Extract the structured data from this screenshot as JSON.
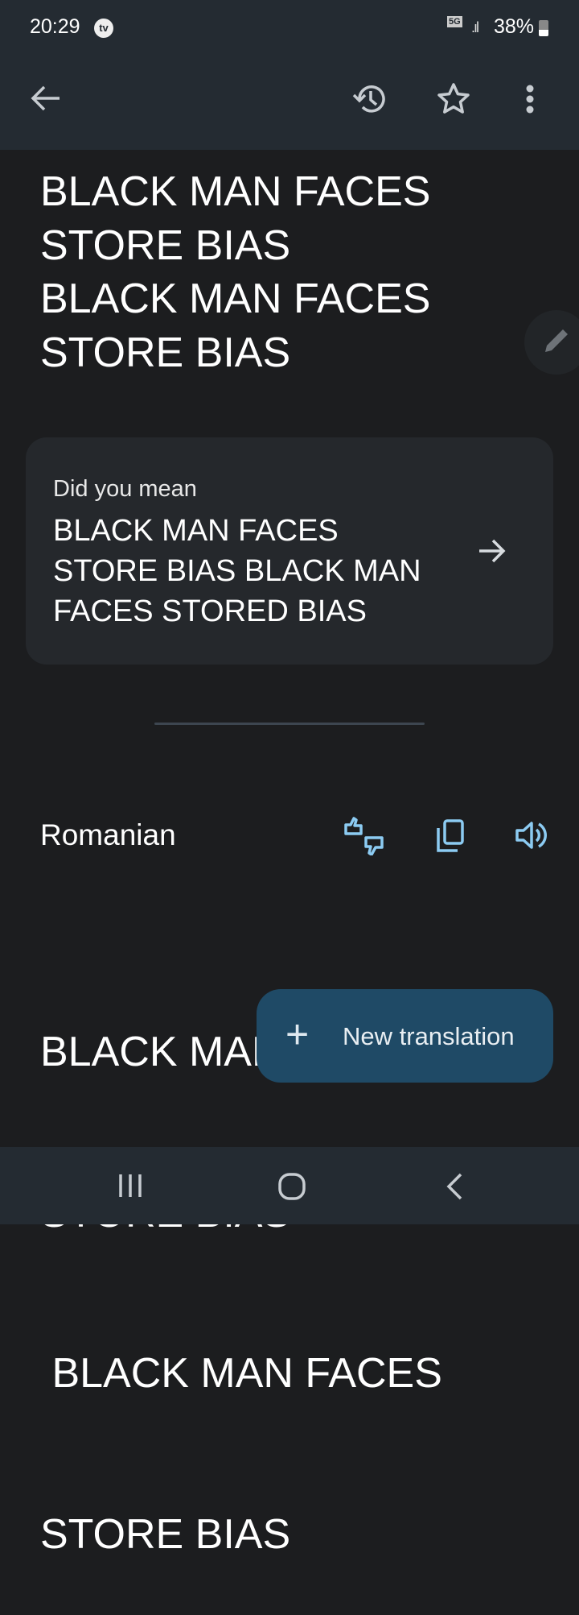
{
  "status_bar": {
    "time": "20:29",
    "tv_badge": "tv",
    "network": "5G",
    "battery": "38%",
    "battery_level": 0.38
  },
  "app_bar": {
    "icons": [
      "arrow-back-icon",
      "history-icon",
      "star-icon",
      "more-vert-icon"
    ]
  },
  "source": {
    "lines": [
      "BLACK MAN FACES",
      "STORE BIAS",
      "BLACK MAN FACES",
      "STORE BIAS"
    ]
  },
  "suggestion": {
    "label": "Did you mean",
    "lines": [
      "BLACK MAN FACES",
      "STORE BIAS BLACK MAN",
      "FACES STORED BIAS"
    ]
  },
  "target": {
    "language": "Romanian",
    "lines": [
      "BLACK MAN FACES",
      "STORE BIAS",
      " BLACK MAN FACES",
      "STORE BIAS"
    ],
    "accent": "#8ccbf2"
  },
  "fab": {
    "label": "New translation"
  }
}
